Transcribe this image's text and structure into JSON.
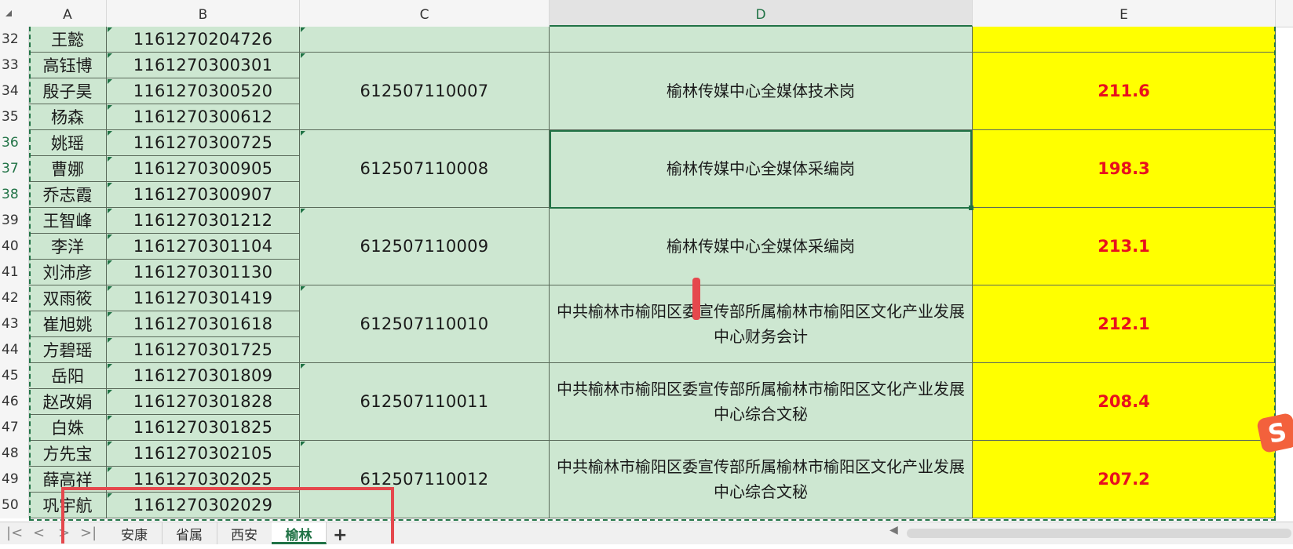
{
  "columns": [
    "A",
    "B",
    "C",
    "D",
    "E"
  ],
  "rows": [
    {
      "n": "32",
      "name": "王懿",
      "id": "1161270204726"
    },
    {
      "n": "33",
      "name": "高钰博",
      "id": "1161270300301"
    },
    {
      "n": "34",
      "name": "殷子昊",
      "id": "1161270300520"
    },
    {
      "n": "35",
      "name": "杨森",
      "id": "1161270300612"
    },
    {
      "n": "36",
      "name": "姚瑶",
      "id": "1161270300725"
    },
    {
      "n": "37",
      "name": "曹娜",
      "id": "1161270300905"
    },
    {
      "n": "38",
      "name": "乔志霞",
      "id": "1161270300907"
    },
    {
      "n": "39",
      "name": "王智峰",
      "id": "1161270301212"
    },
    {
      "n": "40",
      "name": "李洋",
      "id": "1161270301104"
    },
    {
      "n": "41",
      "name": "刘沛彦",
      "id": "1161270301130"
    },
    {
      "n": "42",
      "name": "双雨筱",
      "id": "1161270301419"
    },
    {
      "n": "43",
      "name": "崔旭姚",
      "id": "1161270301618"
    },
    {
      "n": "44",
      "name": "方碧瑶",
      "id": "1161270301725"
    },
    {
      "n": "45",
      "name": "岳阳",
      "id": "1161270301809"
    },
    {
      "n": "46",
      "name": "赵改娟",
      "id": "1161270301828"
    },
    {
      "n": "47",
      "name": "白姝",
      "id": "1161270301825"
    },
    {
      "n": "48",
      "name": "方先宝",
      "id": "1161270302105"
    },
    {
      "n": "49",
      "name": "薛高祥",
      "id": "1161270302025"
    },
    {
      "n": "50",
      "name": "巩宇航",
      "id": "1161270302029"
    }
  ],
  "groups": [
    {
      "code": "",
      "post": "",
      "score": ""
    },
    {
      "code": "612507110007",
      "post": "榆林传媒中心全媒体技术岗",
      "score": "211.6"
    },
    {
      "code": "612507110008",
      "post": "榆林传媒中心全媒体采编岗",
      "score": "198.3"
    },
    {
      "code": "612507110009",
      "post": "榆林传媒中心全媒体采编岗",
      "score": "213.1"
    },
    {
      "code": "612507110010",
      "post": "中共榆林市榆阳区委宣传部所属榆林市榆阳区文化产业发展中心财务会计",
      "score": "212.1"
    },
    {
      "code": "612507110011",
      "post": "中共榆林市榆阳区委宣传部所属榆林市榆阳区文化产业发展中心综合文秘",
      "score": "208.4"
    },
    {
      "code": "612507110012",
      "post": "中共榆林市榆阳区委宣传部所属榆林市榆阳区文化产业发展中心综合文秘",
      "score": "207.2"
    }
  ],
  "selected_column": "D",
  "selected_rows": [
    "36",
    "37",
    "38"
  ],
  "tabs": {
    "nav": [
      "|<",
      "<",
      ">",
      ">|"
    ],
    "sheets": [
      "安康",
      "省属",
      "西安",
      "榆林"
    ],
    "active": "榆林",
    "add": "+"
  },
  "ime_logo": "S",
  "colors": {
    "fill": "#cde7d1",
    "highlight": "#ffff00",
    "score": "#e8101e",
    "accent": "#217346"
  }
}
